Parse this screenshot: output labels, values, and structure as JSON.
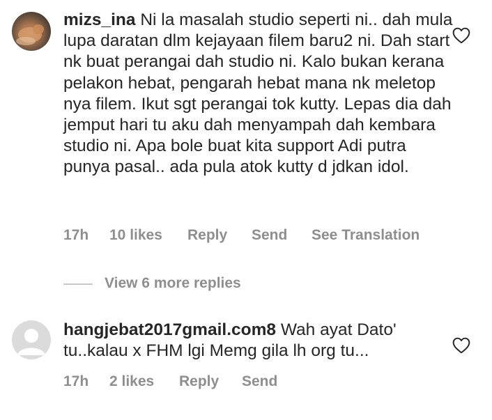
{
  "comments": [
    {
      "username": "mizs_ina",
      "text": "Ni la masalah studio seperti ni.. dah mula lupa daratan dlm kejayaan filem baru2 ni. Dah start nk buat perangai dah studio ni. Kalo bukan kerana pelakon hebat, pengarah hebat mana nk meletop nya filem. Ikut sgt perangai tok kutty. Lepas dia dah jemput hari tu aku dah menyampah dah kembara studio ni. Apa bole buat kita support Adi putra punya pasal.. ada pula atok  kutty d jdkan idol.",
      "time": "17h",
      "likes": "10 likes",
      "reply_label": "Reply",
      "send_label": "Send",
      "translation_label": "See Translation",
      "avatar_icon": "profile-photo-icon"
    },
    {
      "username": "hangjebat2017gmail.com8",
      "text": "Wah ayat Dato' tu..kalau x FHM lgi Memg gila lh org tu...",
      "time": "17h",
      "likes": "2 likes",
      "reply_label": "Reply",
      "send_label": "Send",
      "avatar_icon": "default-avatar-icon"
    }
  ],
  "view_replies": {
    "label": "View 6 more replies"
  },
  "colors": {
    "text": "#262626",
    "secondary": "#8e8e8e",
    "divider": "#c7c7c7",
    "default_avatar": "#dbdbdb"
  }
}
